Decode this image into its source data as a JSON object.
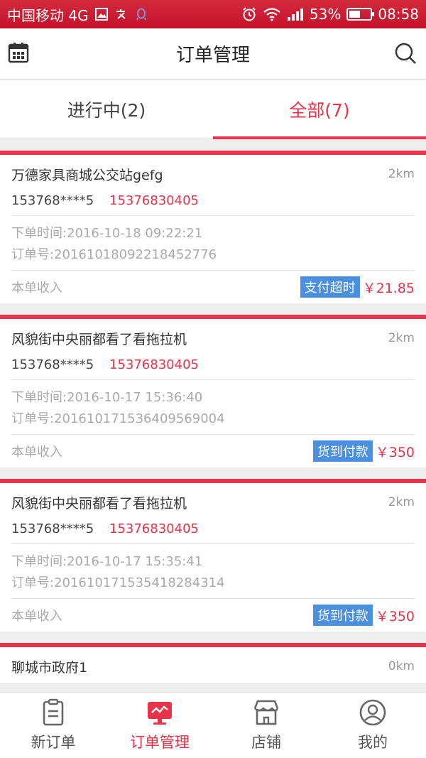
{
  "status_bar": {
    "carrier": "中国移动 4G",
    "battery": "53%",
    "battery_level": 0.53,
    "time": "08:58"
  },
  "header": {
    "title": "订单管理",
    "left_icon": "calendar-icon",
    "right_icon": "search-icon"
  },
  "tabs": [
    {
      "label": "进行中(2)",
      "active": false
    },
    {
      "label": "全部(7)",
      "active": true
    }
  ],
  "orders": [
    {
      "store": "万德家具商城公交站gefg",
      "distance": "2km",
      "masked_phone": "153768****5",
      "phone": "15376830405",
      "order_time": "下单时间:2016-10-18 09:22:21",
      "order_no": "订单号:20161018092218452776",
      "income_label": "本单收入",
      "badge": "支付超时",
      "amount": "￥21.85"
    },
    {
      "store": "风貌街中央丽都看了看拖拉机",
      "distance": "2km",
      "masked_phone": "153768****5",
      "phone": "15376830405",
      "order_time": "下单时间:2016-10-17 15:36:40",
      "order_no": "订单号:20161017153640956900​4",
      "income_label": "本单收入",
      "badge": "货到付款",
      "amount": "￥350"
    },
    {
      "store": "风貌街中央丽都看了看拖拉机",
      "distance": "2km",
      "masked_phone": "153768****5",
      "phone": "15376830405",
      "order_time": "下单时间:2016-10-17 15:35:41",
      "order_no": "订单号:20161017153541828431​4",
      "income_label": "本单收入",
      "badge": "货到付款",
      "amount": "￥350"
    },
    {
      "store": "聊城市政府1",
      "distance": "0km",
      "masked_phone": "",
      "phone": "",
      "order_time": "",
      "order_no": "",
      "income_label": "",
      "badge": "",
      "amount": ""
    }
  ],
  "bottom_nav": [
    {
      "label": "新订单",
      "icon": "clipboard-icon",
      "active": false
    },
    {
      "label": "订单管理",
      "icon": "monitor-icon",
      "active": true
    },
    {
      "label": "店铺",
      "icon": "store-icon",
      "active": false
    },
    {
      "label": "我的",
      "icon": "user-icon",
      "active": false
    }
  ],
  "colors": {
    "accent": "#e8334a",
    "badge_blue": "#4a8fe0",
    "status_bar": "#c4122a"
  }
}
